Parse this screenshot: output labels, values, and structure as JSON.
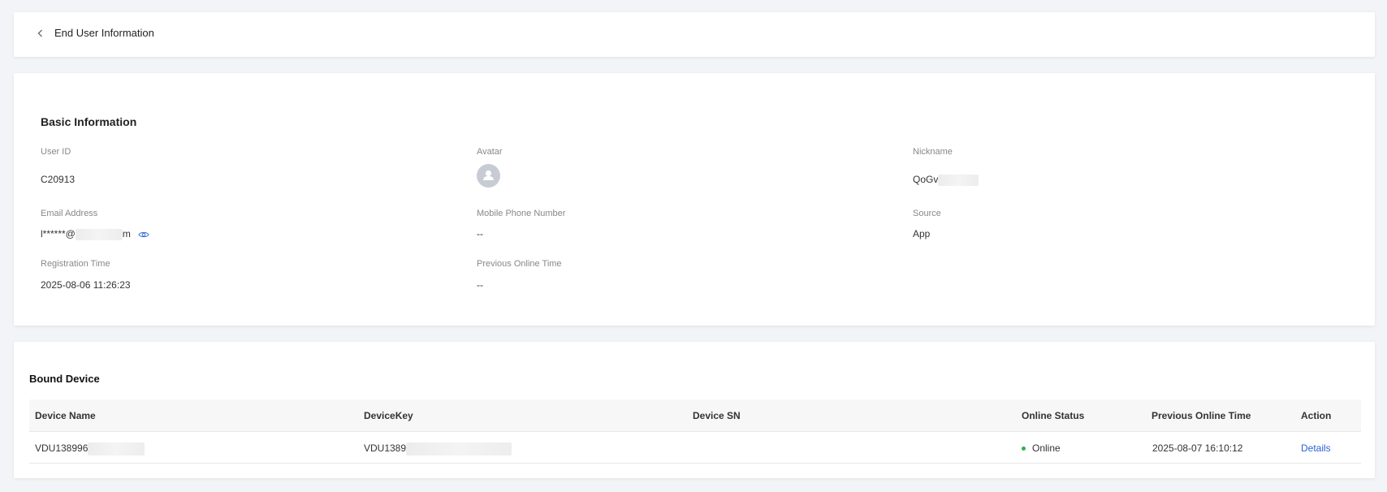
{
  "header": {
    "back_icon": "chevron-left-icon",
    "title": "End User Information"
  },
  "basic_info": {
    "section_title": "Basic Information",
    "user_id": {
      "label": "User ID",
      "value": "C20913"
    },
    "avatar": {
      "label": "Avatar",
      "icon": "user-avatar-icon"
    },
    "nickname": {
      "label": "Nickname",
      "value": "QoGv"
    },
    "email": {
      "label": "Email Address",
      "value_prefix": "l******@",
      "value_suffix": "m",
      "reveal_icon": "eye-icon"
    },
    "mobile": {
      "label": "Mobile Phone Number",
      "value": "--"
    },
    "source": {
      "label": "Source",
      "value": "App"
    },
    "registration_time": {
      "label": "Registration Time",
      "value": "2025-08-06 11:26:23"
    },
    "previous_online_time": {
      "label": "Previous Online Time",
      "value": "--"
    }
  },
  "bound_device": {
    "section_title": "Bound Device",
    "columns": [
      "Device Name",
      "DeviceKey",
      "Device SN",
      "Online Status",
      "Previous Online Time",
      "Action"
    ],
    "rows": [
      {
        "device_name": "VDU138996",
        "device_key": "VDU1389",
        "device_sn": "",
        "online_status": "Online",
        "previous_online_time": "2025-08-07 16:10:12",
        "action": "Details"
      }
    ]
  },
  "colors": {
    "accent": "#2a62d6",
    "online": "#2bb24c",
    "background": "#f3f4f7"
  }
}
